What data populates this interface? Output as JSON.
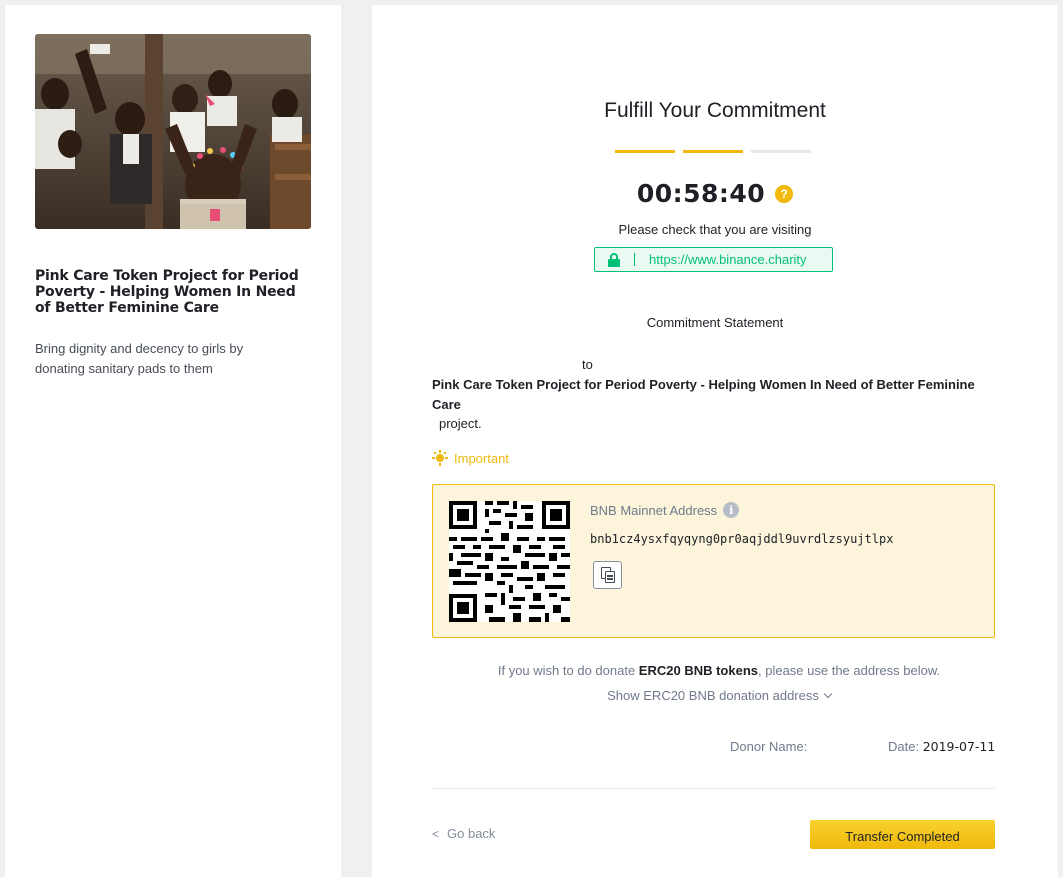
{
  "project": {
    "title": "Pink Care Token Project for Period Poverty - Helping Women In Need of Better Feminine Care",
    "description": "Bring dignity and decency to girls by donating sanitary pads to them"
  },
  "page": {
    "title": "Fulfill Your Commitment",
    "steps": [
      {
        "state": "complete"
      },
      {
        "state": "complete"
      },
      {
        "state": "pending"
      }
    ],
    "countdown": "00:58:40",
    "help_icon": "?",
    "check_text": "Please check that you are visiting",
    "url": "https://www.binance.charity"
  },
  "commitment": {
    "heading": "Commitment Statement",
    "to": "to",
    "project_name": "Pink Care Token Project for Period Poverty - Helping Women In Need of Better Feminine Care",
    "suffix": "project."
  },
  "important": {
    "label": "Important"
  },
  "address": {
    "label": "BNB Mainnet Address",
    "info_icon": "i",
    "value": "bnb1cz4ysxfqyqyng0pr0aqjddl9uvrdlzsyujtlpx"
  },
  "erc20": {
    "note_prefix": "If you wish to do donate ",
    "note_bold": "ERC20 BNB tokens",
    "note_suffix": ", please use the address below.",
    "toggle_label": "Show ERC20 BNB donation address"
  },
  "donor": {
    "name_label": "Donor Name:",
    "date_label": "Date: ",
    "date_value": "2019-07-11"
  },
  "actions": {
    "back_chevron": "<",
    "back_label": "Go back",
    "transfer_label": "Transfer Completed"
  },
  "colors": {
    "accent": "#f0b90b",
    "success": "#02c076",
    "panel_bg": "#fcf5dc"
  }
}
